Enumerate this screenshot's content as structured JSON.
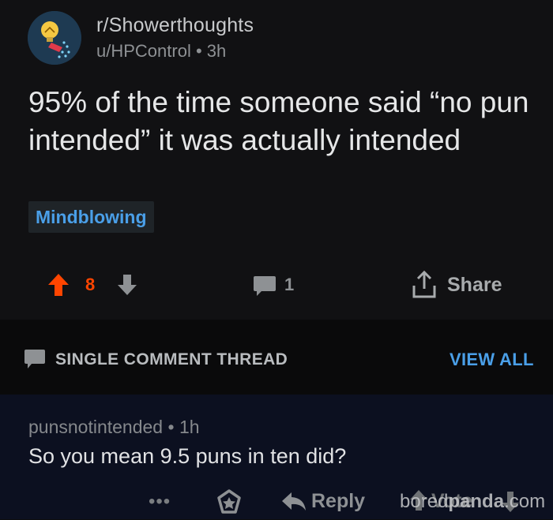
{
  "post": {
    "subreddit": "r/Showerthoughts",
    "author": "u/HPControl",
    "separator": "•",
    "age": "3h",
    "title": "95% of the time someone said “no pun intended” it was actually intended",
    "flair": "Mindblowing",
    "score": "8",
    "comment_count": "1",
    "share_label": "Share",
    "colors": {
      "upvote": "#ff4500",
      "flair_text": "#4a9fe8",
      "avatar_bg": "#1e3a52"
    },
    "icons": [
      "subreddit-avatar-icon",
      "upvote-icon",
      "downvote-icon",
      "comment-icon",
      "share-icon"
    ]
  },
  "thread": {
    "label": "SINGLE COMMENT THREAD",
    "view_all": "VIEW ALL"
  },
  "comment": {
    "author": "punsnotintended",
    "separator": "•",
    "age": "1h",
    "body": "So you mean 9.5 puns in ten did?",
    "more": "•••",
    "reply_label": "Reply",
    "vote_label": "Vote",
    "icons": [
      "more-icon",
      "award-icon",
      "reply-icon",
      "upvote-icon",
      "downvote-icon"
    ]
  },
  "watermark": {
    "prefix": "bored",
    "bold": "panda",
    "suffix": ".com"
  }
}
